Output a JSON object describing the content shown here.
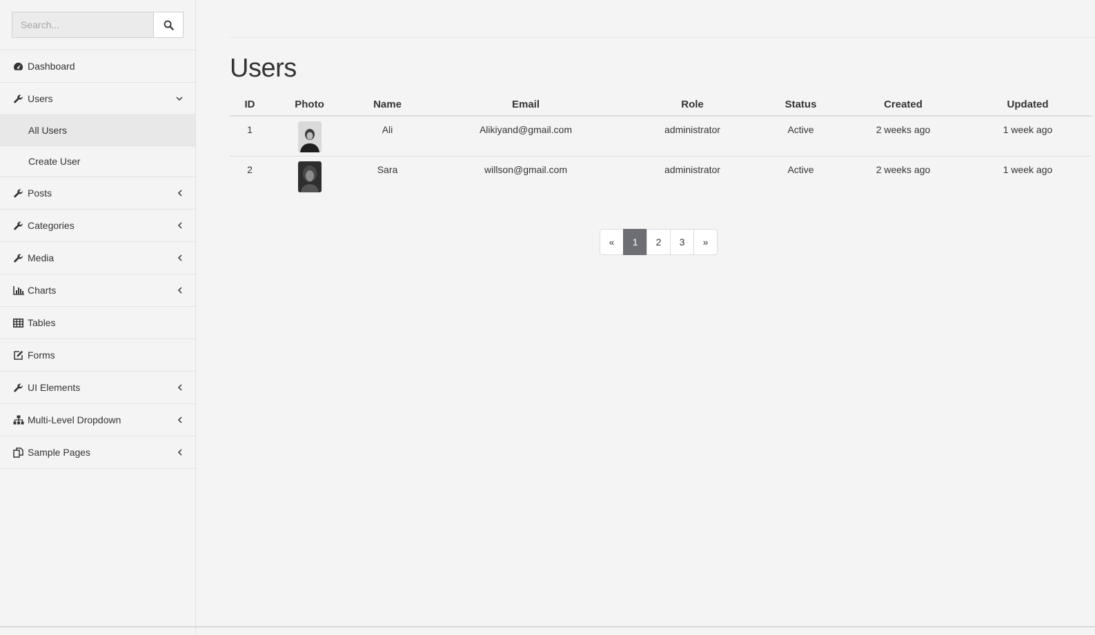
{
  "search": {
    "placeholder": "Search..."
  },
  "sidebar": {
    "items": [
      {
        "label": "Dashboard",
        "icon": "dashboard-icon"
      },
      {
        "label": "Users",
        "icon": "wrench-icon",
        "expanded": true,
        "children": [
          {
            "label": "All Users",
            "active": true
          },
          {
            "label": "Create User"
          }
        ]
      },
      {
        "label": "Posts",
        "icon": "wrench-icon"
      },
      {
        "label": "Categories",
        "icon": "wrench-icon"
      },
      {
        "label": "Media",
        "icon": "wrench-icon"
      },
      {
        "label": "Charts",
        "icon": "bar-chart-icon"
      },
      {
        "label": "Tables",
        "icon": "table-icon"
      },
      {
        "label": "Forms",
        "icon": "edit-icon"
      },
      {
        "label": "UI Elements",
        "icon": "wrench-icon"
      },
      {
        "label": "Multi-Level Dropdown",
        "icon": "sitemap-icon"
      },
      {
        "label": "Sample Pages",
        "icon": "files-icon"
      }
    ]
  },
  "main": {
    "title": "Users",
    "table": {
      "headers": [
        "ID",
        "Photo",
        "Name",
        "Email",
        "Role",
        "Status",
        "Created",
        "Updated"
      ],
      "rows": [
        {
          "id": "1",
          "name": "Ali",
          "email": "Alikiyand@gmail.com",
          "role": "administrator",
          "status": "Active",
          "created": "2 weeks ago",
          "updated": "1 week ago"
        },
        {
          "id": "2",
          "name": "Sara",
          "email": "willson@gmail.com",
          "role": "administrator",
          "status": "Active",
          "created": "2 weeks ago",
          "updated": "1 week ago"
        }
      ]
    },
    "pagination": {
      "prev": "«",
      "pages": [
        "1",
        "2",
        "3"
      ],
      "current": "1",
      "next": "»"
    }
  },
  "colors": {
    "background": "#f4f4f4",
    "active_page": "#6c6e73"
  }
}
